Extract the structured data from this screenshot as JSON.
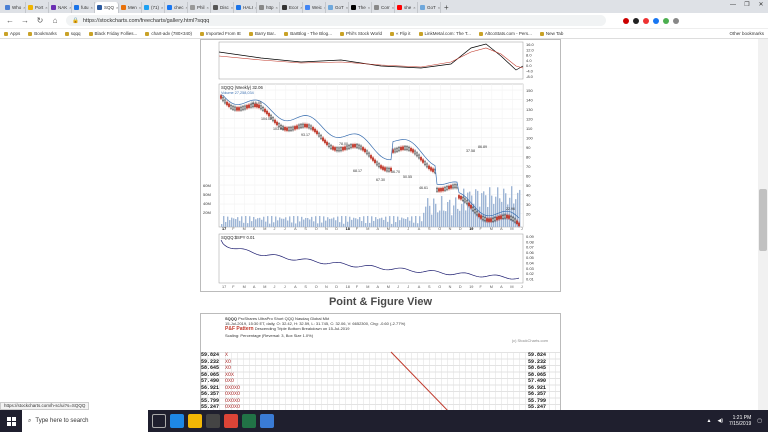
{
  "tabs": [
    {
      "label": "Who",
      "color": "#4a7fd4"
    },
    {
      "label": "Port",
      "color": "#f0b400"
    },
    {
      "label": "NAK",
      "color": "#6b2fb3"
    },
    {
      "label": "futu",
      "color": "#1a73e8"
    },
    {
      "label": "SQQ",
      "color": "#2b5aa0"
    },
    {
      "label": "Men",
      "color": "#e8710a"
    },
    {
      "label": "(71)",
      "color": "#1da1f2"
    },
    {
      "label": "chec",
      "color": "#1877f2"
    },
    {
      "label": "Phil",
      "color": "#999999"
    },
    {
      "label": "Disc",
      "color": "#555555"
    },
    {
      "label": "HALI",
      "color": "#1a73e8"
    },
    {
      "label": "http",
      "color": "#888888"
    },
    {
      "label": "Ecor",
      "color": "#333333"
    },
    {
      "label": "Weic",
      "color": "#4285f4"
    },
    {
      "label": "GoT",
      "color": "#6fa8dc"
    },
    {
      "label": "The",
      "color": "#000000"
    },
    {
      "label": "Corr",
      "color": "#888888"
    },
    {
      "label": "she",
      "color": "#ff0000"
    },
    {
      "label": "GoT",
      "color": "#6fa8dc"
    }
  ],
  "browser": {
    "url": "https://stockcharts.com/freecharts/gallery.html?sqqq",
    "back": "←",
    "forward": "→",
    "reload": "↻",
    "home": "⌂",
    "newtab": "+",
    "min": "—",
    "max": "❐",
    "close": "✕"
  },
  "bookmarks": [
    "Apps",
    "Bookmarks",
    "sqqq",
    "Black Friday Follies...",
    "chart-adv (780×340)",
    "Imported From IE",
    "Barry Bar..",
    "BarBlog - The Blog...",
    "Phil's Stock World",
    "« Flip it",
    "LinkMetal.com: The T...",
    "AltcoStats.com - Pers...",
    "New Tab"
  ],
  "other_bookmarks": "Other bookmarks",
  "pf": {
    "section_title": "Point & Figure View",
    "symbol": "SQQQ",
    "desc": "ProShares UltraPro Short QQQ  Nasdaq Global Mkt",
    "quote": "15-Jul-2019, 15:30 ET, daily, O: 32.42, H: 32.59, L: 31.745, C: 32.06, V: 6652300, Chg: -0.60 (-2.77%)",
    "pattern_label": "P&F Pattern",
    "pattern_text": "Descending Triple Bottom Breakdown on 15-Jul-2019",
    "scaling": "Scaling: Percentage (Reversal: 3, Box Size 1.0%)",
    "credit": "(c) StockCharts.com",
    "prices": [
      "59.824",
      "59.232",
      "58.645",
      "58.065",
      "57.490",
      "56.921",
      "56.357",
      "55.799",
      "55.247",
      "54.700",
      "54.158"
    ],
    "marks": [
      "X",
      "XO",
      "XO",
      "XOX",
      "OXO",
      "OXOXO",
      "OXOXO",
      "OXOXO",
      "OXOXO",
      "OXOXO",
      "OXOXO"
    ]
  },
  "status_url": "https://stockcharts.com/h-sc/ui?s=SQQQ",
  "taskbar": {
    "search_placeholder": "Type here to search",
    "time": "1:21 PM",
    "date": "7/15/2019"
  },
  "chart": {
    "main_title": "SQQQ (Weekly) 32.06",
    "main_legend": "Volume 27,258,034",
    "ratio_title": "SQQQ:$SPY 0.01",
    "macd_levels": [
      "16.0",
      "12.0",
      "8.0",
      "4.0",
      "0.0",
      "-4.0",
      "-8.0"
    ],
    "main_levels": [
      "150",
      "140",
      "130",
      "120",
      "110",
      "100",
      "90",
      "80",
      "70",
      "60",
      "50",
      "40",
      "30",
      "20"
    ],
    "ratio_levels": [
      "0.09",
      "0.08",
      "0.07",
      "0.06",
      "0.05",
      "0.04",
      "0.03",
      "0.02",
      "0.01"
    ],
    "vol_levels": [
      "60M",
      "50M",
      "40M",
      "20M"
    ],
    "months": [
      "17",
      "F",
      "M",
      "A",
      "M",
      "J",
      "J",
      "A",
      "S",
      "O",
      "N",
      "D",
      "18",
      "F",
      "M",
      "A",
      "M",
      "J",
      "J",
      "A",
      "S",
      "O",
      "N",
      "D",
      "19",
      "F",
      "M",
      "A",
      "M",
      "J"
    ],
    "year_markers": [
      "17",
      "18",
      "19"
    ],
    "annotations": [
      "116.96",
      "104.02",
      "103.04",
      "93.17",
      "78.00",
      "68.17",
      "67.30",
      "56.70",
      "50.55",
      "46.61",
      "37.58",
      "86.89",
      "22.96"
    ]
  },
  "colors": {
    "ma": "#3a6fb0",
    "up": "#2a2a2a",
    "down": "#c0392b",
    "volume": "#9fb6d6",
    "pfline": "#c0392b"
  }
}
